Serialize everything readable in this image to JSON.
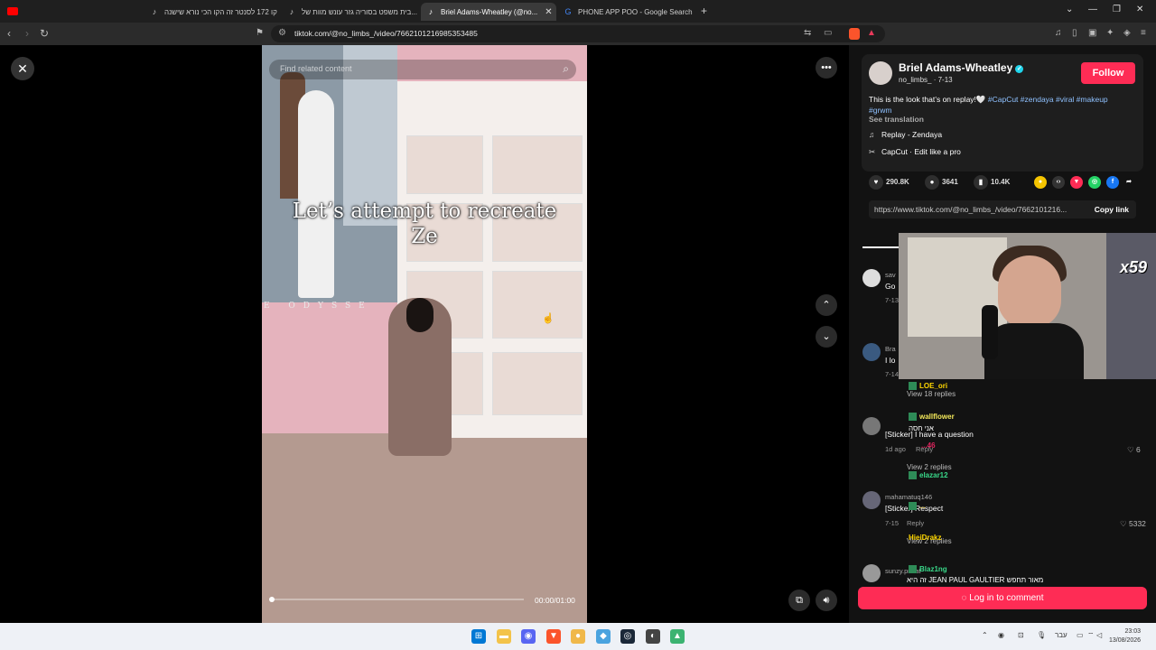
{
  "browser": {
    "tabs": [
      {
        "label": "קו 172 לסנטר זה הקו הכי נורא שישנה",
        "icon": "youtube-icon"
      },
      {
        "label": "בית משפט בסוריה גזר עונש מוות של...",
        "icon": "tiktok-icon"
      },
      {
        "label": "Briel Adams-Wheatley (@no...",
        "icon": "tiktok-icon"
      },
      {
        "label": "PHONE APP POO - Google Search",
        "icon": "google-icon"
      }
    ],
    "new_tab": "+",
    "url": "tiktok.com/@no_limbs_/video/7662101216985353485"
  },
  "video": {
    "search_placeholder": "Find related content",
    "caption": "Let’s attempt to recreate Ze",
    "overlay_text": "E ODYSSE",
    "time": "00:00/01:00",
    "progress": 0.0
  },
  "author": {
    "name": "Briel Adams-Wheatley",
    "handle": "no_limbs_",
    "sep": " · ",
    "date": "7-13",
    "follow": "Follow"
  },
  "post": {
    "desc_text": "This is the look that’s on replay!🤍",
    "hashtags": "#CapCut #zendaya #viral #makeup",
    "hashtags2": "#grwm",
    "see_translation": "See translation",
    "music": "Replay - Zendaya",
    "capcut": "CapCut · Edit like a pro",
    "likes": "290.8K",
    "comments": "3641",
    "saves": "10.4K",
    "link": "https://www.tiktok.com/@no_limbs_/video/7662101216...",
    "copy_link": "Copy link"
  },
  "comments": [
    {
      "user": "sav",
      "text": "Go",
      "sub": "7-13"
    },
    {
      "user": "Bra",
      "text": "I lo",
      "sub": "7-14"
    },
    {
      "user": "",
      "text": "View 18 replies",
      "sub": ""
    },
    {
      "user": "",
      "text": "[Sticker] I have a question",
      "sub": "1d ago",
      "reply": "Reply",
      "likes": "6"
    },
    {
      "user": "",
      "text": "View 2 replies",
      "sub": ""
    },
    {
      "user": "mahamatuq146",
      "text": "[Sticker] Respect",
      "sub": "7-15",
      "reply": "Reply",
      "likes": "5332"
    },
    {
      "user": "",
      "text": "View 2 replies",
      "sub": ""
    },
    {
      "user": "sunzy.privat",
      "text": "",
      "sub": ""
    }
  ],
  "login": "Log in to comment",
  "stream": {
    "multiplier": "x59",
    "chat": [
      {
        "name": "LOE_ori",
        "color": "#ffd700",
        "msg": ""
      },
      {
        "name": "wallflower",
        "color": "#f3e85a",
        "msg": "אני חסה"
      },
      {
        "name": "...46",
        "color": "#e0245e",
        "msg": ""
      },
      {
        "name": "elazar12",
        "color": "#39d98a",
        "msg": ""
      },
      {
        "name": "...",
        "color": "#e0c03a",
        "msg": ""
      },
      {
        "name": "HieiDrakz",
        "color": "#ffd700",
        "msg": ""
      },
      {
        "name": "Blaz1ng",
        "color": "#39d98a",
        "msg": "זה היא JEAN PAUL GAULTIER מאור תחפש"
      }
    ]
  },
  "taskbar": {
    "clock_time": "23:03",
    "clock_date": "13/08/2026",
    "lang": "עבר"
  }
}
